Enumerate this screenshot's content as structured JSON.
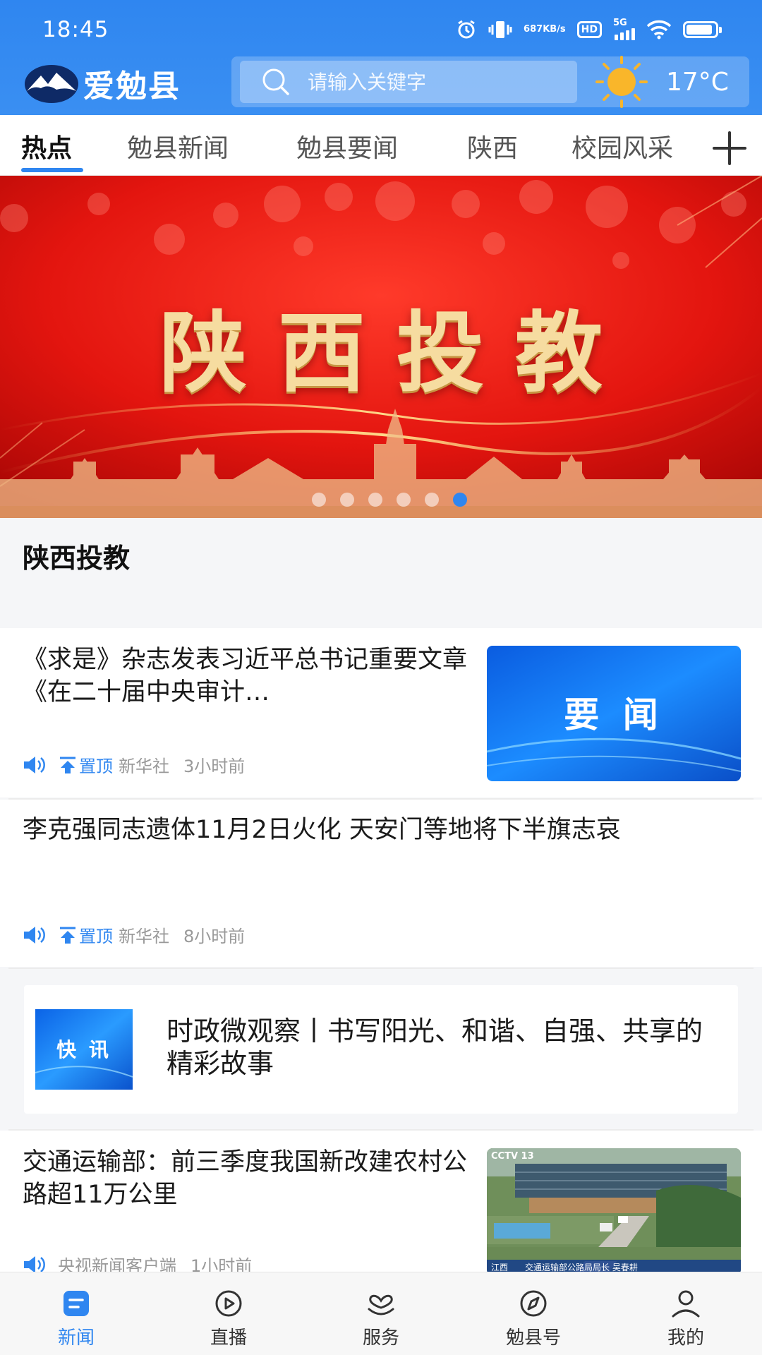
{
  "status_bar": {
    "time": "18:45",
    "net_speed_value": "687",
    "net_speed_unit": "KB/s",
    "hd_label": "HD",
    "network_label": "5G",
    "battery_level": 0.9
  },
  "app": {
    "name": "爱勉县",
    "accent_color": "#2f86f0"
  },
  "search": {
    "placeholder": "请输入关键字"
  },
  "weather": {
    "temperature": "17°C",
    "icon": "sun-icon"
  },
  "tabs": [
    {
      "label": "热点",
      "active": true
    },
    {
      "label": "勉县新闻",
      "active": false
    },
    {
      "label": "勉县要闻",
      "active": false
    },
    {
      "label": "陕西",
      "active": false
    },
    {
      "label": "校园风采",
      "active": false
    }
  ],
  "banner": {
    "title": "陕西投教",
    "caption": "陕西投教",
    "slide_count": 6,
    "active_slide": 6
  },
  "feed": [
    {
      "headline": "《求是》杂志发表习近平总书记重要文章《在二十届中央审计…",
      "pinned_label": "置顶",
      "source": "新华社",
      "time": "3小时前",
      "thumb_text": "要 闻"
    },
    {
      "headline": "李克强同志遗体11月2日火化 天安门等地将下半旗志哀",
      "pinned_label": "置顶",
      "source": "新华社",
      "time": "8小时前"
    },
    {
      "headline": "时政微观察丨书写阳光、和谐、自强、共享的精彩故事",
      "thumb_text": "快 讯"
    },
    {
      "headline": "交通运输部：前三季度我国新改建农村公路超11万公里",
      "source": "央视新闻客户端",
      "time": "1小时前",
      "thumb_channel": "CCTV 13",
      "thumb_caption": "江西　　交通运输部公路局局长 吴春耕"
    }
  ],
  "bottom_nav": [
    {
      "label": "新闻",
      "icon": "news-icon",
      "active": true
    },
    {
      "label": "直播",
      "icon": "play-icon",
      "active": false
    },
    {
      "label": "服务",
      "icon": "service-icon",
      "active": false
    },
    {
      "label": "勉县号",
      "icon": "compass-icon",
      "active": false
    },
    {
      "label": "我的",
      "icon": "user-icon",
      "active": false
    }
  ]
}
